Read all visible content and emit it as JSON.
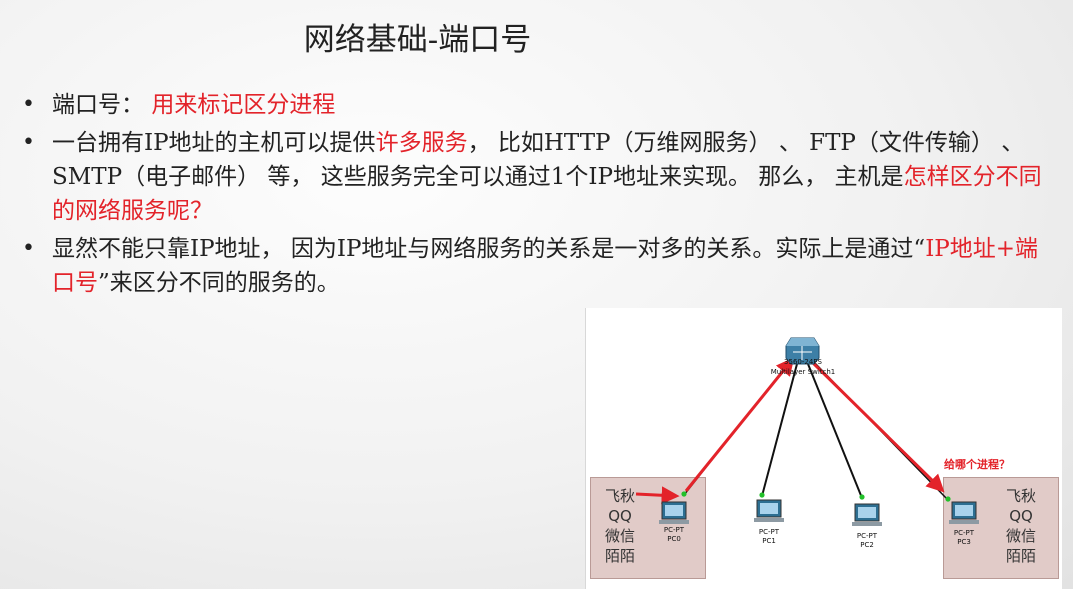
{
  "title": "网络基础-端口号",
  "bullets": [
    {
      "bullet": "•",
      "segments": [
        {
          "text": "端口号： ",
          "color": "black"
        },
        {
          "text": "用来标记区分进程",
          "color": "red"
        }
      ]
    },
    {
      "bullet": "•",
      "segments": [
        {
          "text": "一台拥有IP地址的主机可以提供",
          "color": "black"
        },
        {
          "text": "许多服务",
          "color": "red"
        },
        {
          "text": "， 比如HTTP（万维网服务） 、 FTP（文件传输） 、 SMTP（电子邮件） 等， 这些服务完全可以通过1个IP地址来实现。 那么， 主机是",
          "color": "black"
        },
        {
          "text": "怎样区分不同的网络服务呢？",
          "color": "red"
        }
      ]
    },
    {
      "bullet": "•",
      "segments": [
        {
          "text": " 显然不能只靠IP地址， 因为IP地址与网络服务的关系是一对多的关系。实际上是通过“",
          "color": "black"
        },
        {
          "text": "IP地址+端口号",
          "color": "red"
        },
        {
          "text": "”来区分不同的服务的。",
          "color": "black"
        }
      ]
    }
  ],
  "diagram": {
    "switch": {
      "name": "3560-24PS",
      "label": "Multilayer Switch1",
      "icon": "multilayer-switch-icon"
    },
    "hosts": [
      {
        "type": "PC-PT",
        "name": "PC0",
        "icon": "pc-icon"
      },
      {
        "type": "PC-PT",
        "name": "PC1",
        "icon": "pc-icon"
      },
      {
        "type": "PC-PT",
        "name": "PC2",
        "icon": "pc-icon"
      },
      {
        "type": "PC-PT",
        "name": "PC3",
        "icon": "pc-icon"
      }
    ],
    "left_services": [
      "飞秋",
      "QQ",
      "微信",
      "陌陌"
    ],
    "right_services": [
      "飞秋",
      "QQ",
      "微信",
      "陌陌"
    ],
    "question": "给哪个进程？",
    "colors": {
      "arrow": "#e3232a",
      "zone": "#c8a09b",
      "link": "#111111",
      "port": "#22c02a"
    }
  },
  "colors": {
    "accent_red": "#e3232a",
    "text": "#222222"
  }
}
